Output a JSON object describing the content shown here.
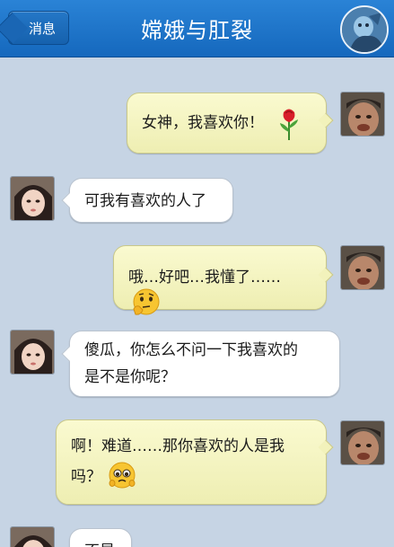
{
  "header": {
    "back_label": "消息",
    "title": "嫦娥与肛裂"
  },
  "messages": [
    {
      "side": "right",
      "text": "女神，我喜欢你！",
      "emoji": "rose-icon"
    },
    {
      "side": "left",
      "text": "可我有喜欢的人了"
    },
    {
      "side": "right",
      "text": "哦…好吧…我懂了……",
      "emoji": "thinking-face-icon"
    },
    {
      "side": "left",
      "lines": [
        "傻瓜，你怎么不问一下我喜欢的",
        "是不是你呢？"
      ]
    },
    {
      "side": "right",
      "lines": [
        "啊！难道……那你喜欢的人是我",
        "吗？"
      ],
      "emoji": "pleading-face-icon"
    },
    {
      "side": "left",
      "text": "不是"
    }
  ],
  "colors": {
    "header": "#1a6fc4",
    "background": "#c6d4e4",
    "bubble_self": "#f2f2bb",
    "bubble_other": "#ffffff"
  }
}
